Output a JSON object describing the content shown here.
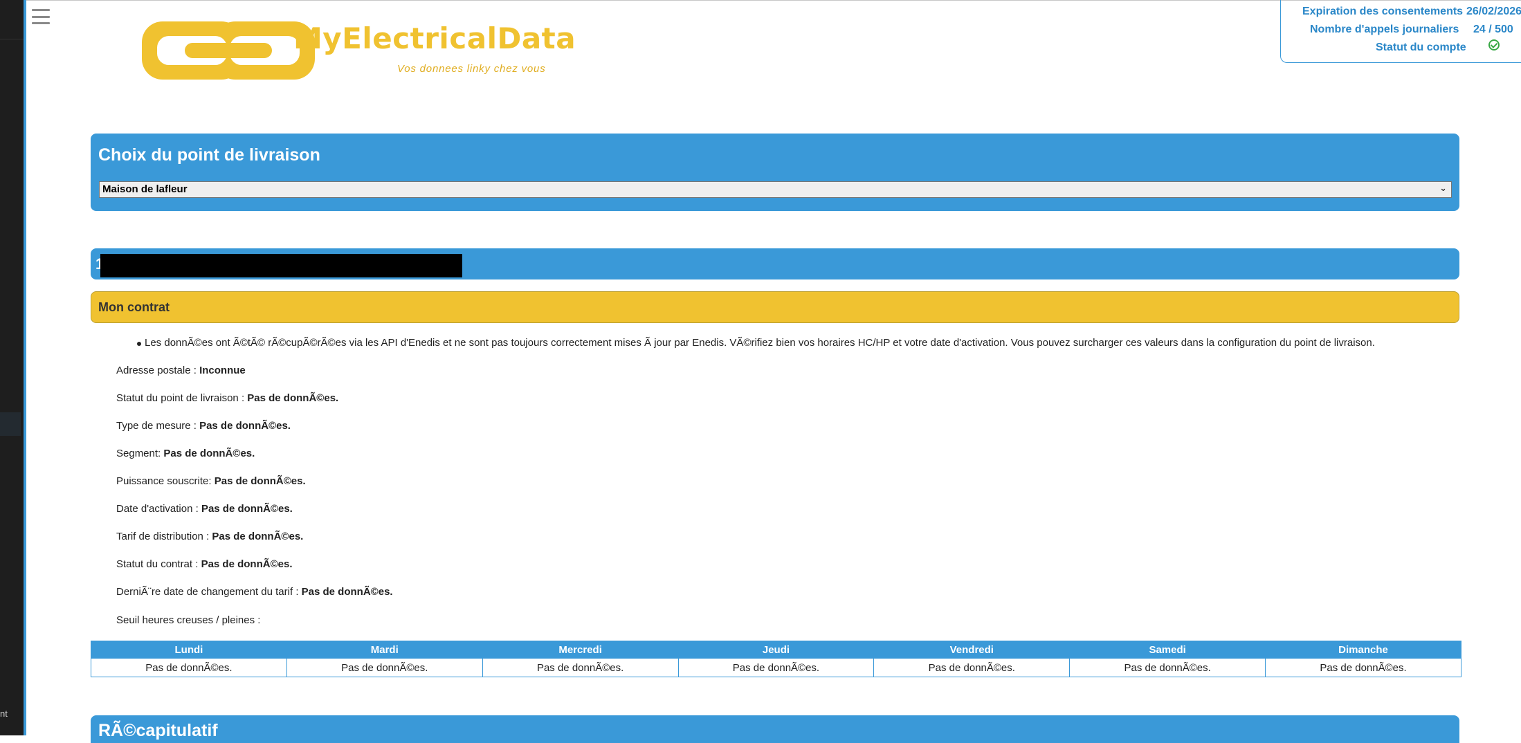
{
  "sidebar": {
    "fragment_text": "nt"
  },
  "header": {
    "logo_title": "MyElectricalData",
    "logo_tagline": "Vos donnees linky chez vous",
    "colors": {
      "brand_yellow": "#f0c230",
      "accent_blue": "#3a99d8"
    }
  },
  "account": {
    "rows": [
      {
        "label": "Expiration des consentements",
        "value": "26/02/2026"
      },
      {
        "label": "Nombre d'appels journaliers",
        "value": "24 / 500"
      },
      {
        "label": "Statut du compte",
        "icon": "check-circle-icon"
      }
    ]
  },
  "delivery_point": {
    "title": "Choix du point de livraison",
    "selected": "Maison de lafleur"
  },
  "pdl_header": {
    "visible_fragment": "1"
  },
  "contract": {
    "title": "Mon contrat",
    "notice": "Les donnÃ©es ont Ã©tÃ© rÃ©cupÃ©rÃ©es via les API d'Enedis et ne sont pas toujours correctement mises Ã  jour par Enedis. VÃ©rifiez bien vos horaires HC/HP et votre date d'activation. Vous pouvez surcharger ces valeurs dans la configuration du point de livraison.",
    "fields": [
      {
        "label": "Adresse postale : ",
        "value": "Inconnue"
      },
      {
        "label": "Statut du point de livraison : ",
        "value": "Pas de donnÃ©es."
      },
      {
        "label": "Type de mesure : ",
        "value": "Pas de donnÃ©es."
      },
      {
        "label": "Segment: ",
        "value": "Pas de donnÃ©es."
      },
      {
        "label": "Puissance souscrite: ",
        "value": "Pas de donnÃ©es."
      },
      {
        "label": "Date d'activation : ",
        "value": "Pas de donnÃ©es."
      },
      {
        "label": "Tarif de distribution : ",
        "value": "Pas de donnÃ©es."
      },
      {
        "label": "Statut du contrat : ",
        "value": "Pas de donnÃ©es."
      },
      {
        "label": "DerniÃ¨re date de changement du tarif : ",
        "value": "Pas de donnÃ©es."
      }
    ],
    "hc_label": "Seuil heures creuses / pleines :",
    "hc_table": {
      "headers": [
        "Lundi",
        "Mardi",
        "Mercredi",
        "Jeudi",
        "Vendredi",
        "Samedi",
        "Dimanche"
      ],
      "values": [
        "Pas de donnÃ©es.",
        "Pas de donnÃ©es.",
        "Pas de donnÃ©es.",
        "Pas de donnÃ©es.",
        "Pas de donnÃ©es.",
        "Pas de donnÃ©es.",
        "Pas de donnÃ©es."
      ]
    }
  },
  "recap": {
    "title": "RÃ©capitulatif"
  }
}
